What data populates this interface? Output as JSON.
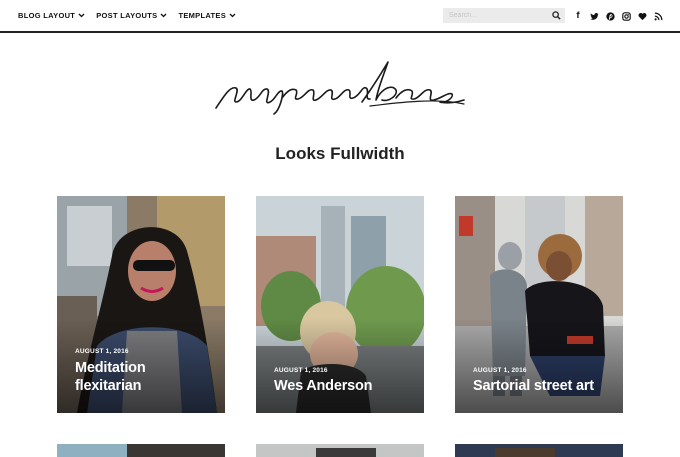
{
  "nav": {
    "menu": [
      {
        "label": "BLOG LAYOUT"
      },
      {
        "label": "POST LAYOUTS"
      },
      {
        "label": "TEMPLATES"
      }
    ],
    "search": {
      "placeholder": "Search..."
    },
    "social_icons": [
      "facebook-icon",
      "twitter-icon",
      "pinterest-icon",
      "instagram-icon",
      "heart-icon",
      "rss-icon"
    ]
  },
  "logo": {
    "text": "paperbag"
  },
  "section": {
    "title": "Looks Fullwidth"
  },
  "posts": [
    {
      "date": "AUGUST 1, 2016",
      "title": "Meditation flexitarian"
    },
    {
      "date": "AUGUST 1, 2016",
      "title": "Wes Anderson"
    },
    {
      "date": "AUGUST 1, 2016",
      "title": "Sartorial street art"
    }
  ],
  "colors": {
    "text": "#222222",
    "search_bg": "#ebebeb",
    "accent": "#111111"
  }
}
